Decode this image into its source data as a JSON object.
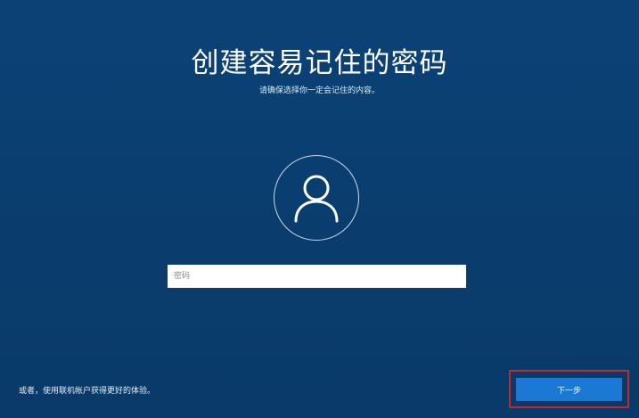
{
  "page": {
    "title": "创建容易记住的密码",
    "subtitle": "请确保选择你一定会记住的内容。"
  },
  "avatar": {
    "icon": "user-icon"
  },
  "password": {
    "placeholder": "密码",
    "value": ""
  },
  "footer": {
    "alt_link": "或者，使用联机帐户获得更好的体验。",
    "next_label": "下一步"
  },
  "colors": {
    "background": "#0a3d6e",
    "accent": "#1b78d4",
    "highlight_outline": "#c1272d"
  }
}
